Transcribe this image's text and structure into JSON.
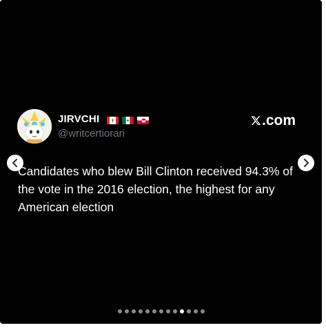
{
  "post": {
    "display_name": "JIRVCHI",
    "handle": "@writcertiorari",
    "flags": [
      "flag-canada",
      "flag-mexico",
      "flag-greenland"
    ],
    "brand": ".com",
    "text": "Candidates who blew Bill Clinton received 94.3% of the vote in the 2016 election, the highest for any American election"
  },
  "carousel": {
    "prev_icon": "chevron-left-icon",
    "next_icon": "chevron-right-icon",
    "dot_count": 13,
    "active_index": 9
  },
  "colors": {
    "background": "#000000",
    "text_primary": "#ffffff",
    "text_secondary": "#71767b",
    "dot_inactive": "#8a8a8a",
    "dot_active": "#ffffff"
  }
}
